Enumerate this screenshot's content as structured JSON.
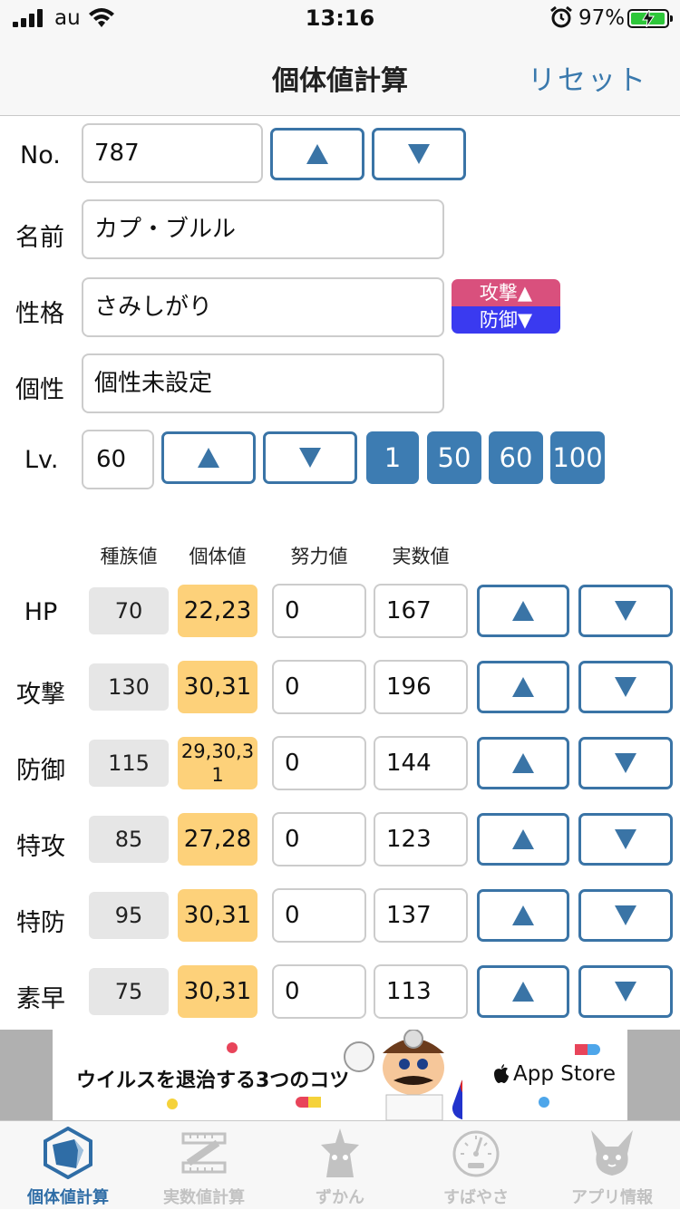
{
  "status_bar": {
    "carrier": "au",
    "time": "13:16",
    "battery": "97%"
  },
  "nav": {
    "title": "個体値計算",
    "reset": "リセット"
  },
  "form": {
    "no_label": "No.",
    "no_value": "787",
    "name_label": "名前",
    "name_value": "カプ・ブルル",
    "nature_label": "性格",
    "nature_value": "さみしがり",
    "nature_up": "攻撃▲",
    "nature_down": "防御▼",
    "characteristic_label": "個性",
    "characteristic_value": "個性未設定",
    "level_label": "Lv.",
    "level_value": "60",
    "level_presets": [
      "1",
      "50",
      "60",
      "100"
    ]
  },
  "stats": {
    "headers": {
      "base": "種族値",
      "iv": "個体値",
      "ev": "努力値",
      "real": "実数値"
    },
    "rows": [
      {
        "label": "HP",
        "base": "70",
        "iv": "22,23",
        "ev": "0",
        "real": "167"
      },
      {
        "label": "攻撃",
        "base": "130",
        "iv": "30,31",
        "ev": "0",
        "real": "196"
      },
      {
        "label": "防御",
        "base": "115",
        "iv": "29,30,31",
        "ev": "0",
        "real": "144"
      },
      {
        "label": "特攻",
        "base": "85",
        "iv": "27,28",
        "ev": "0",
        "real": "123"
      },
      {
        "label": "特防",
        "base": "95",
        "iv": "30,31",
        "ev": "0",
        "real": "137"
      },
      {
        "label": "素早",
        "base": "75",
        "iv": "30,31",
        "ev": "0",
        "real": "113"
      }
    ]
  },
  "ad": {
    "text": "ウイルスを退治する3つのコツ",
    "store": "App Store"
  },
  "tabs": [
    {
      "label": "個体値計算",
      "icon": "hexagon-icon"
    },
    {
      "label": "実数値計算",
      "icon": "ruler-icon"
    },
    {
      "label": "ずかん",
      "icon": "pokemon-icon"
    },
    {
      "label": "すばやさ",
      "icon": "speedometer-icon"
    },
    {
      "label": "アプリ情報",
      "icon": "pikachu-icon"
    }
  ],
  "colors": {
    "accent": "#3a74a6",
    "iv_fill": "#fdd17a",
    "base_fill": "#e6e6e6",
    "nature_up": "#d9507d",
    "nature_down": "#3a3af0"
  }
}
